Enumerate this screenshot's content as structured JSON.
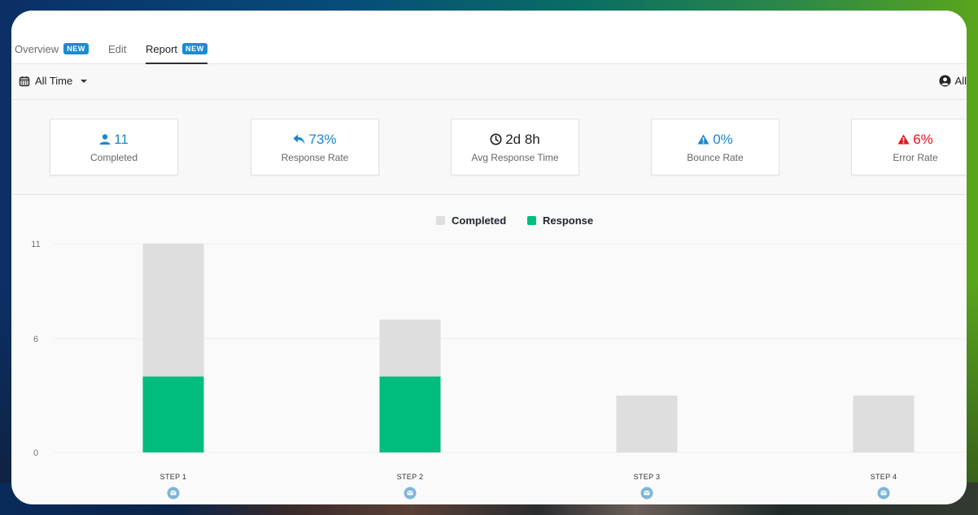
{
  "tabs": [
    {
      "label": "Overview",
      "badge": "NEW",
      "active": false
    },
    {
      "label": "Edit",
      "badge": null,
      "active": false
    },
    {
      "label": "Report",
      "badge": "NEW",
      "active": true
    }
  ],
  "filters": {
    "date_range": {
      "icon": "calendar-icon",
      "label": "All Time"
    },
    "audience": {
      "icon": "user-circle-icon",
      "label": "All"
    }
  },
  "stats": [
    {
      "icon": "user-icon",
      "value": "11",
      "label": "Completed",
      "color": "#1b87c9"
    },
    {
      "icon": "reply-icon",
      "value": "73%",
      "label": "Response Rate",
      "color": "#1b87c9"
    },
    {
      "icon": "clock-icon",
      "value": "2d 8h",
      "label": "Avg Response Time",
      "color": "#222222"
    },
    {
      "icon": "warning-icon",
      "value": "0%",
      "label": "Bounce Rate",
      "color": "#1b87c9"
    },
    {
      "icon": "warning-icon",
      "value": "6%",
      "label": "Error Rate",
      "color": "#e3141e"
    }
  ],
  "chart_data": {
    "type": "bar",
    "stacking": "overlay",
    "title": "",
    "xlabel": "",
    "ylabel": "",
    "categories": [
      "STEP 1",
      "STEP 2",
      "STEP 3",
      "STEP 4"
    ],
    "category_icon": "email-icon",
    "series": [
      {
        "name": "Completed",
        "color": "#dedede",
        "values": [
          11,
          7,
          3,
          3
        ]
      },
      {
        "name": "Response",
        "color": "#00bc7d",
        "values": [
          4,
          4,
          0,
          0
        ]
      }
    ],
    "ylim": [
      0,
      11
    ],
    "yticks": [
      0,
      6,
      11
    ],
    "grid": true,
    "legend_position": "top-center"
  }
}
